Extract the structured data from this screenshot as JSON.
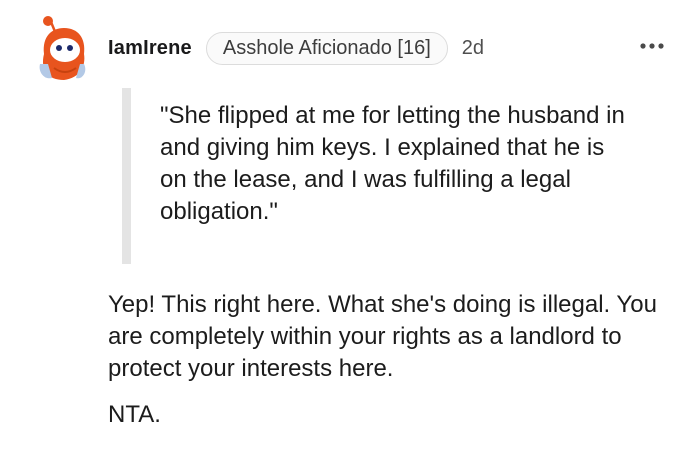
{
  "comment": {
    "username": "IamIrene",
    "flair": "Asshole Aficionado [16]",
    "timestamp": "2d",
    "quote": "\"She flipped at me for letting the husband in and giving him keys. I explained that he is on the lease, and I was fulfilling a legal obligation.\"",
    "paragraphs": [
      "Yep! This right here. What she's doing is illegal. You are completely within your rights as a landlord to protect your interests here.",
      "NTA."
    ]
  },
  "icons": {
    "avatar": "snoo-avatar-icon",
    "more": "more-options-icon"
  },
  "colors": {
    "avatar_hood": "#e8541e",
    "quote_bar": "#e4e4e4",
    "text": "#1c1c1c"
  }
}
